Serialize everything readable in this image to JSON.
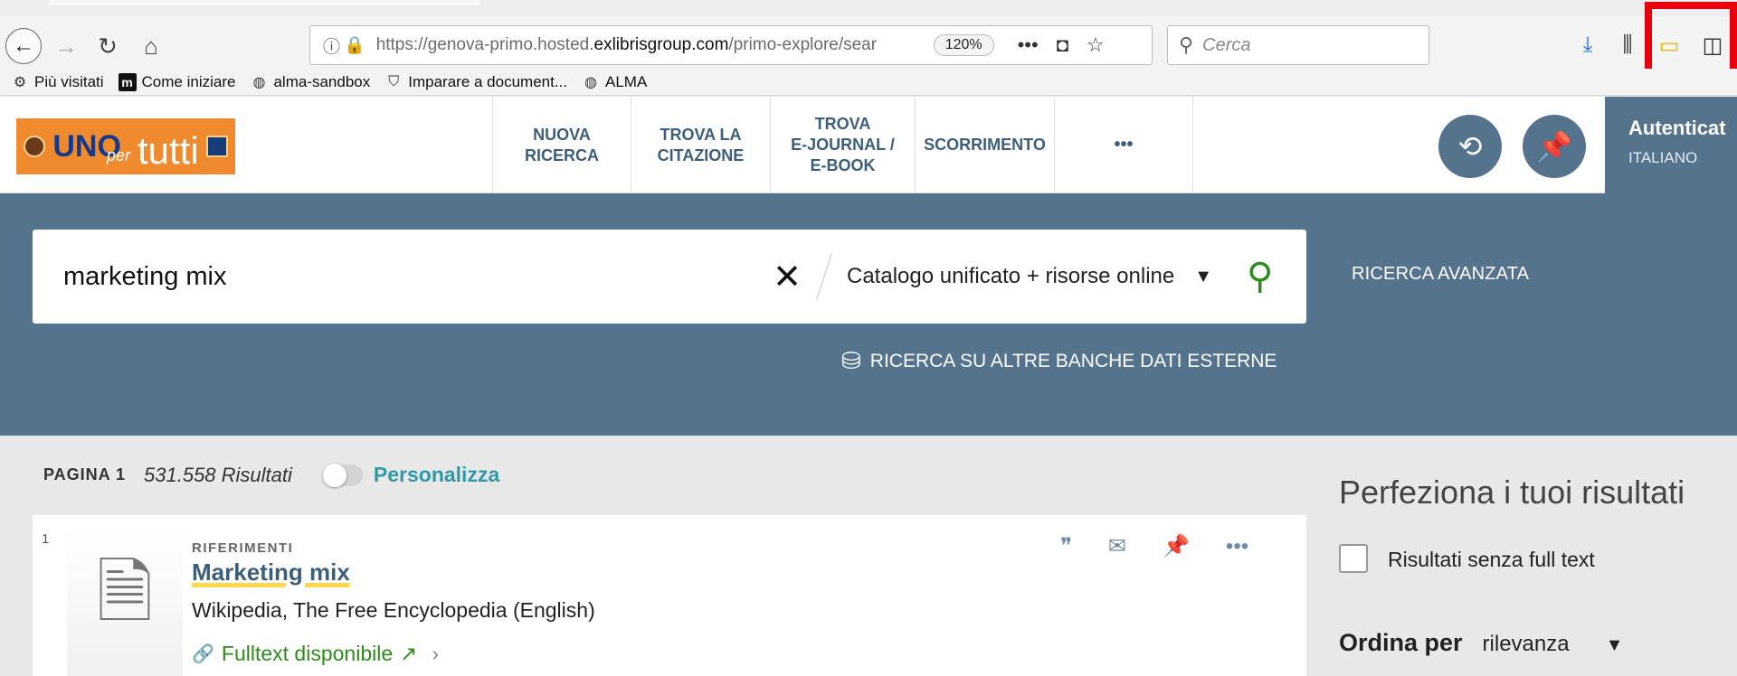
{
  "browser": {
    "url_prefix": "https://genova-primo.hosted.",
    "url_domain": "exlibrisgroup.com",
    "url_suffix": "/primo-explore/sear",
    "zoom": "120%",
    "search_placeholder": "Cerca",
    "bookmarks": [
      {
        "label": "Più visitati",
        "icon": "gear-icon"
      },
      {
        "label": "Come iniziare",
        "icon": "m-icon"
      },
      {
        "label": "alma-sandbox",
        "icon": "globe-icon"
      },
      {
        "label": "Imparare a document...",
        "icon": "shield-icon"
      },
      {
        "label": "ALMA",
        "icon": "globe-icon"
      }
    ],
    "highlight_color": "#e8000d"
  },
  "header": {
    "logo_uno": "UNO",
    "logo_per": "per",
    "logo_tutti": "tutti",
    "nav": [
      {
        "label": "NUOVA\nRICERCA"
      },
      {
        "label": "TROVA LA\nCITAZIONE"
      },
      {
        "label": "TROVA\nE-JOURNAL /\nE-BOOK"
      },
      {
        "label": "SCORRIMENTO"
      },
      {
        "label": "•••"
      }
    ],
    "auth_label": "Autenticat",
    "language": "ITALIANO",
    "accent_color": "#56738e"
  },
  "search": {
    "query": "marketing mix",
    "scope": "Catalogo unificato + risorse online",
    "advanced_label": "RICERCA AVANZATA",
    "external_label": "RICERCA SU ALTRE BANCHE DATI ESTERNE"
  },
  "results": {
    "page_label": "PAGINA 1",
    "count": "531.558 Risultati",
    "personalize_label": "Personalizza",
    "items": [
      {
        "index": "1",
        "type": "RIFERIMENTI",
        "title": "Marketing mix",
        "source": "Wikipedia, The Free Encyclopedia (English)",
        "availability": "Fulltext disponibile"
      }
    ]
  },
  "facets": {
    "title": "Perfeziona i tuoi risultati",
    "checkbox_label": "Risultati senza full text",
    "sort_label": "Ordina per",
    "sort_value": "rilevanza"
  }
}
